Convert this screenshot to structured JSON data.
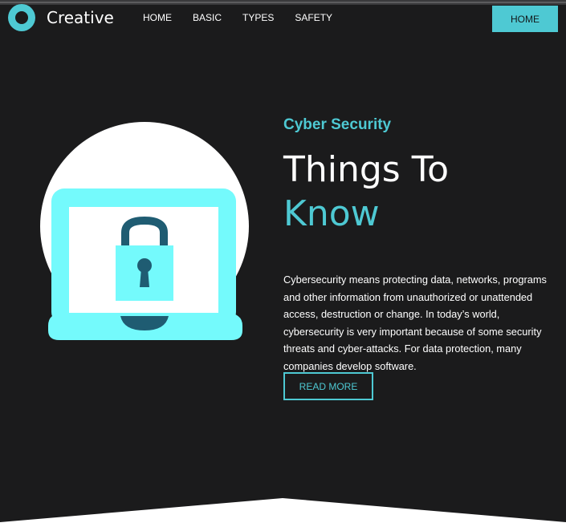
{
  "header": {
    "logo_text": "Creative",
    "nav": [
      "HOME",
      "BASIC",
      "TYPES",
      "SAFETY"
    ],
    "cta_label": "HOME"
  },
  "hero": {
    "eyebrow": "Cyber Security",
    "title_line1": "Things To",
    "title_line2": "Know",
    "description": "Cybersecurity means protecting data, networks, programs and other information from unauthorized or unattended access, destruction or change. In today’s world, cybersecurity is very important because of some security threats and cyber-attacks. For data protection, many companies develop software.",
    "button_label": "READ MORE",
    "illustration_icon": "laptop-lock-icon"
  },
  "colors": {
    "accent": "#4ec9d3",
    "background": "#1b1b1c",
    "laptop": "#74fafc",
    "lock_dark": "#1f5c72"
  }
}
